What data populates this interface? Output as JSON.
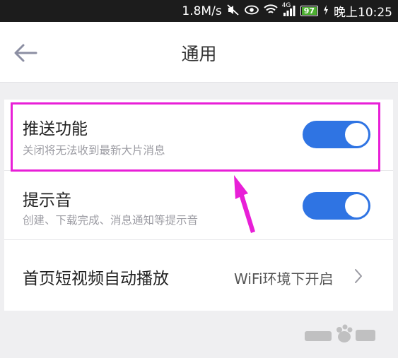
{
  "status_bar": {
    "speed": "1.8M/s",
    "signal_label": "4G",
    "battery": "97",
    "time": "晚上10:25"
  },
  "header": {
    "title": "通用",
    "back_icon": "arrow-left-icon"
  },
  "settings": [
    {
      "title": "推送功能",
      "subtitle": "关闭将无法收到最新大片消息",
      "toggle_on": true
    },
    {
      "title": "提示音",
      "subtitle": "创建、下载完成、消息通知等提示音",
      "toggle_on": true
    },
    {
      "title": "首页短视频自动播放",
      "value": "WiFi环境下开启"
    }
  ],
  "colors": {
    "accent": "#2f74e3",
    "annotation": "#e81fd7"
  }
}
